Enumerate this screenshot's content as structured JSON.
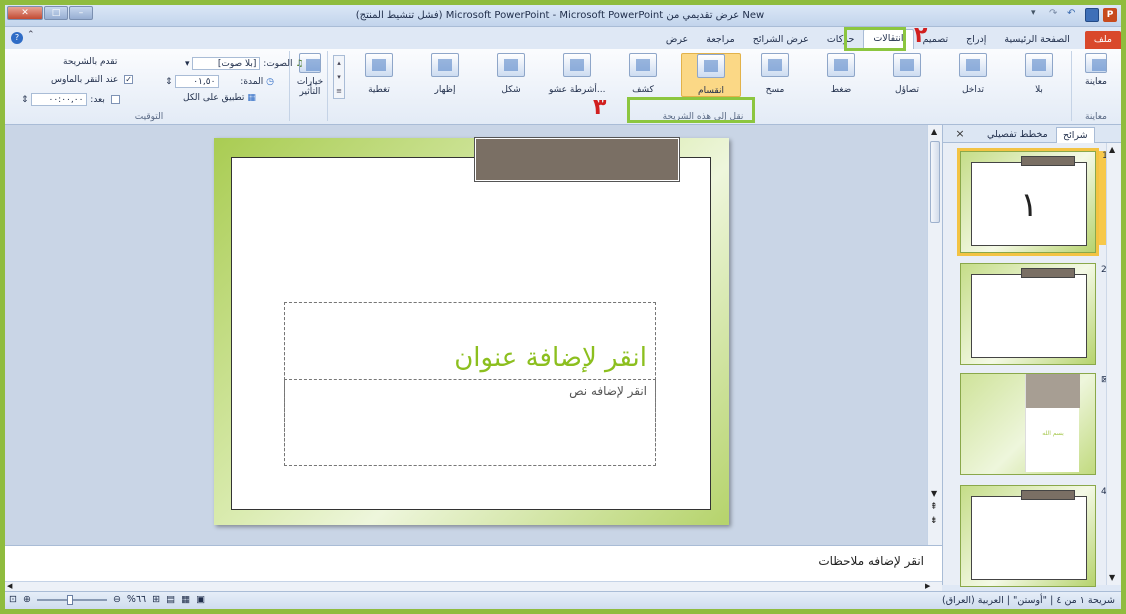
{
  "window": {
    "title": "New عرض تقديمي من Microsoft PowerPoint - Microsoft PowerPoint (فشل تنشيط المنتج)",
    "app_badge": "P"
  },
  "tabs": [
    {
      "label": "ملف"
    },
    {
      "label": "الصفحة الرئيسية"
    },
    {
      "label": "إدراج"
    },
    {
      "label": "تصميم"
    },
    {
      "label": "انتقالات"
    },
    {
      "label": "حركات"
    },
    {
      "label": "عرض الشرائح"
    },
    {
      "label": "مراجعة"
    },
    {
      "label": "عرض"
    }
  ],
  "ribbon": {
    "preview": {
      "label": "معاينة",
      "group": "معاينة"
    },
    "transitions": [
      {
        "label": "بلا"
      },
      {
        "label": "تداخل"
      },
      {
        "label": "تصاؤل"
      },
      {
        "label": "ضغط"
      },
      {
        "label": "مسح"
      },
      {
        "label": "انقسام"
      },
      {
        "label": "كشف"
      },
      {
        "label": "أشرطة عشو..."
      },
      {
        "label": "شكل"
      },
      {
        "label": "إظهار"
      },
      {
        "label": "تغطية"
      }
    ],
    "transitions_group": "نقل إلى هذه الشريحة",
    "effect_options": "خيارات التأثير",
    "timing": {
      "sound_label": "الصوت:",
      "sound_value": "[بلا صوت]",
      "duration_label": "المدة:",
      "duration_value": "٠١,٥٠",
      "apply_all": "تطبيق على الكل",
      "advance_label": "تقدم بالشريحة",
      "on_click": "عند النقر بالماوس",
      "after_label": "بعد:",
      "after_value": "٠٠:٠٠,٠٠",
      "group": "التوقيت"
    }
  },
  "annotations": {
    "mark2": "٢",
    "mark3": "٣"
  },
  "pane": {
    "tab_slides": "شرائح",
    "tab_outline": "مخطط تفصيلي",
    "close": "×",
    "thumbs": [
      {
        "num": "1",
        "content": "١"
      },
      {
        "num": "2",
        "content": ""
      },
      {
        "num": "",
        "content": "بسم الله"
      },
      {
        "num": "4",
        "content": ""
      }
    ]
  },
  "slide": {
    "title_placeholder": "انقر لإضافة عنوان",
    "subtitle_placeholder": "انقر لإضافه نص"
  },
  "notes": {
    "placeholder": "انقر لإضافه ملاحظات"
  },
  "status": {
    "slide_info": "شريحة ١ من ٤",
    "theme": "\"أوستن\"",
    "language": "العربية (العراق)",
    "zoom": "%٦٦"
  },
  "colors": {
    "highlight": "#8cc63f",
    "annotation": "#d11f1f",
    "title": "#8cbf1f",
    "file_tab": "#d9482b"
  }
}
